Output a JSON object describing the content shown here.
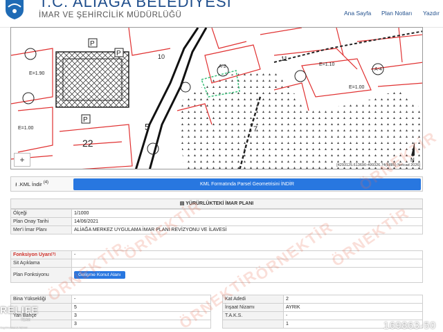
{
  "header": {
    "title": "T.C. ALİAĞA BELEDİYESİ",
    "subtitle": "İMAR VE ŞEHİRCİLİK MÜDÜRLÜĞÜ",
    "nav": [
      "Ana Sayfa",
      "Plan Notları",
      "Yazdır"
    ]
  },
  "map": {
    "zoom_in": "+",
    "coords": "[4293125.613690-499326.74(8885) Netcad 2026]",
    "labels": [
      "22",
      "5",
      "7",
      "10",
      "11",
      "E=1.90",
      "E=1.00",
      "E=1.10",
      "E=1.00",
      "A-2",
      "A-4",
      "P",
      "P",
      "P"
    ]
  },
  "kml": {
    "label": ".KML İndir",
    "badge": "(4)",
    "button": "KML Formatında Parsel Geometrisini İNDİR"
  },
  "plan": {
    "section_title": "YÜRÜRLÜKTEKİ İMAR PLANI",
    "rows": [
      {
        "label": "Ölçeği",
        "value": "1/1000"
      },
      {
        "label": "Plan Onay Tarihi",
        "value": "14/06/2021"
      },
      {
        "label": "Mer'i İmar Planı",
        "value": "ALİAĞA MERKEZ UYGULAMA İMAR PLANI REVİZYONU VE İLAVESİ"
      }
    ]
  },
  "function": {
    "warning_label": "Fonksiyon Uyarı",
    "warning_badge": "(?)",
    "warning_value": "-",
    "site_label": "Sit Açıklama",
    "site_value": "",
    "plan_function_label": "Plan Fonksiyonu",
    "plan_function_button": "Gelişme Konut Alanı"
  },
  "details_left": [
    {
      "label": "Bina Yüksekliği",
      "value": "-"
    },
    {
      "label": "",
      "value": "5"
    },
    {
      "label": "Yan Bahçe",
      "value": "3"
    },
    {
      "label": "",
      "value": "3"
    }
  ],
  "details_right": [
    {
      "label": "Kat Adedi",
      "value": "2"
    },
    {
      "label": "İnşaat Nizamı",
      "value": "AYRIK"
    },
    {
      "label": "T.A.K.S.",
      "value": "-"
    },
    {
      "label": "",
      "value": "1"
    }
  ],
  "watermarks": {
    "brand": "ÖRNEKTİR",
    "agency": "RELIFE",
    "agency_sub": "TEAM",
    "agency_tag": "Gayrimenkul & Yatırım",
    "listing_no": "169863-50"
  },
  "colors": {
    "accent": "#2877e0",
    "title": "#1f4e8c",
    "parcel_lines": "#e03030",
    "warning": "#d0302a"
  }
}
